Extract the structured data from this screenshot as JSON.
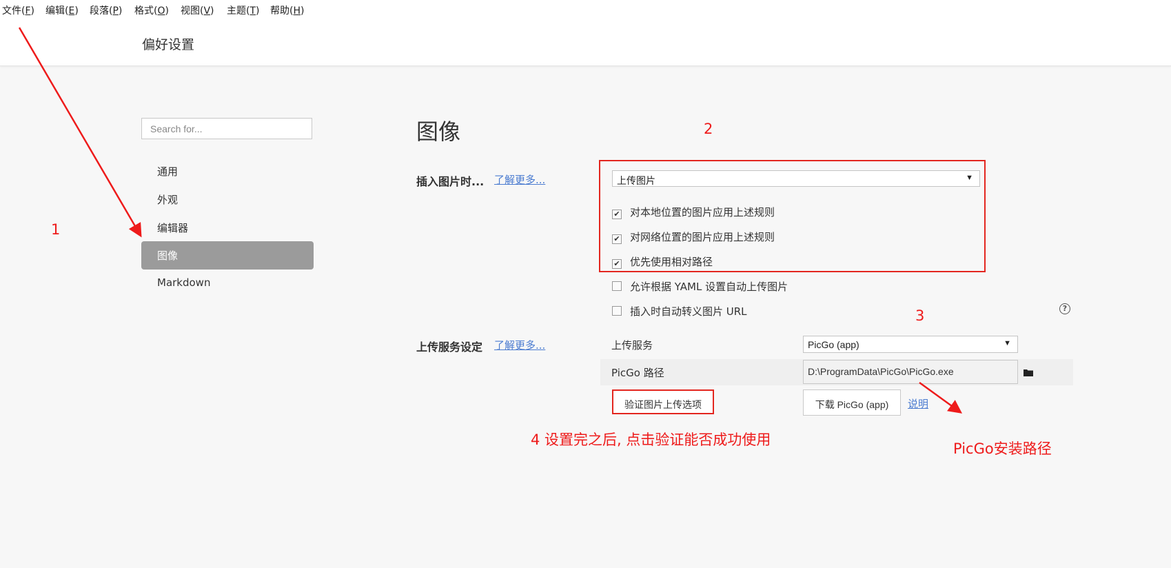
{
  "menubar": {
    "items": [
      {
        "text": "文件(",
        "key": "F",
        "close": ")"
      },
      {
        "text": "编辑(",
        "key": "E",
        "close": ")"
      },
      {
        "text": "段落(",
        "key": "P",
        "close": ")"
      },
      {
        "text": "格式(",
        "key": "O",
        "close": ")"
      },
      {
        "text": "视图(",
        "key": "V",
        "close": ")"
      },
      {
        "text": "主题(",
        "key": "T",
        "close": ")"
      },
      {
        "text": "帮助(",
        "key": "H",
        "close": ")"
      }
    ]
  },
  "window": {
    "title": "偏好设置"
  },
  "sidebar": {
    "search_placeholder": "Search for...",
    "items": [
      {
        "label": "通用",
        "active": false
      },
      {
        "label": "外观",
        "active": false
      },
      {
        "label": "编辑器",
        "active": false
      },
      {
        "label": "图像",
        "active": true
      },
      {
        "label": "Markdown",
        "active": false
      }
    ]
  },
  "main": {
    "title": "图像",
    "insert_image": {
      "label": "插入图片时...",
      "learn_more": "了解更多...",
      "action_value": "上传图片",
      "options": [
        {
          "label": "对本地位置的图片应用上述规则",
          "checked": true
        },
        {
          "label": "对网络位置的图片应用上述规则",
          "checked": true
        },
        {
          "label": "优先使用相对路径",
          "checked": true
        },
        {
          "label": "允许根据 YAML 设置自动上传图片",
          "checked": false
        },
        {
          "label": "插入时自动转义图片 URL",
          "checked": false
        }
      ]
    },
    "upload_service": {
      "label": "上传服务设定",
      "learn_more": "了解更多...",
      "service_label": "上传服务",
      "service_value": "PicGo (app)",
      "path_label": "PicGo 路径",
      "path_value": "D:\\ProgramData\\PicGo\\PicGo.exe",
      "verify_button": "验证图片上传选项",
      "download_button": "下载 PicGo (app)",
      "help_link": "说明"
    }
  },
  "annotations": {
    "step1": "1",
    "step2": "2",
    "step3": "3",
    "step4": "4 设置完之后, 点击验证能否成功使用",
    "picgo_path_note": "PicGo安装路径",
    "color": "#ee1b1b"
  },
  "icons": {
    "help": "question-circle-icon",
    "folder": "folder-icon",
    "caret": "caret-down-icon",
    "checkbox": "checkmark-icon"
  }
}
